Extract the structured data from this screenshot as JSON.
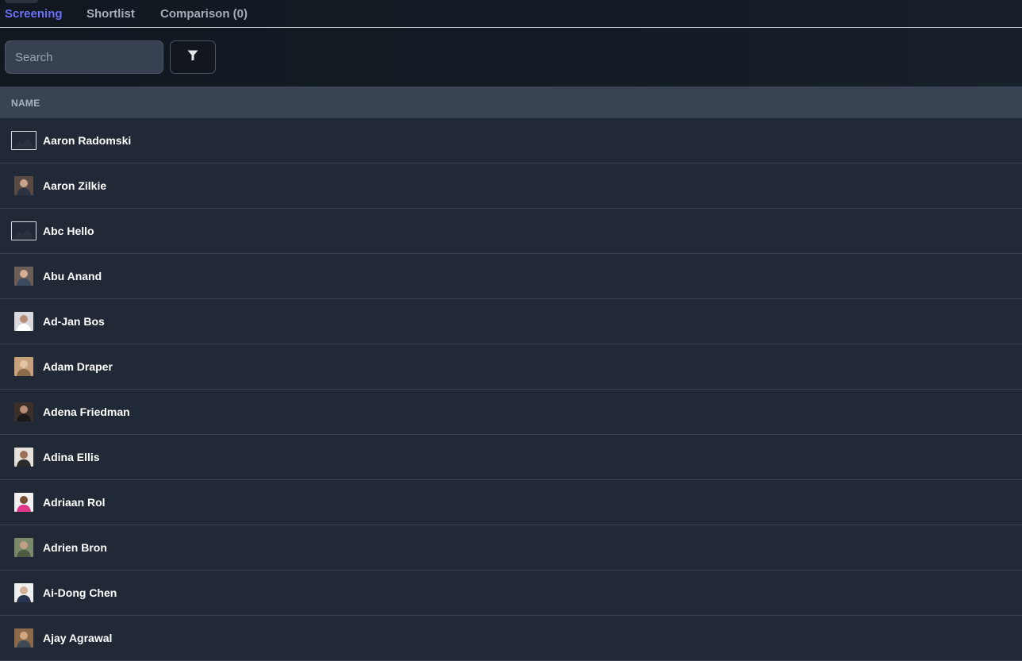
{
  "tabs": {
    "screening": "Screening",
    "shortlist": "Shortlist",
    "comparison": "Comparison (0)"
  },
  "search": {
    "placeholder": "Search"
  },
  "filter": {
    "icon": "filter-icon"
  },
  "table": {
    "header": "NAME",
    "rows": [
      {
        "name": "Aaron Radomski",
        "avatar": "broken-image"
      },
      {
        "name": "Aaron Zilkie",
        "avatar": "photo"
      },
      {
        "name": "Abc Hello",
        "avatar": "broken-image"
      },
      {
        "name": "Abu Anand",
        "avatar": "photo"
      },
      {
        "name": "Ad-Jan Bos",
        "avatar": "photo"
      },
      {
        "name": "Adam Draper",
        "avatar": "photo"
      },
      {
        "name": "Adena Friedman",
        "avatar": "photo"
      },
      {
        "name": "Adina Ellis",
        "avatar": "photo"
      },
      {
        "name": "Adriaan Rol",
        "avatar": "photo"
      },
      {
        "name": "Adrien Bron",
        "avatar": "photo"
      },
      {
        "name": "Ai-Dong Chen",
        "avatar": "photo"
      },
      {
        "name": "Ajay Agrawal",
        "avatar": "photo"
      }
    ]
  },
  "colors": {
    "active_tab": "#6b6ff5",
    "background": "#222936",
    "header_bg": "#394354"
  }
}
